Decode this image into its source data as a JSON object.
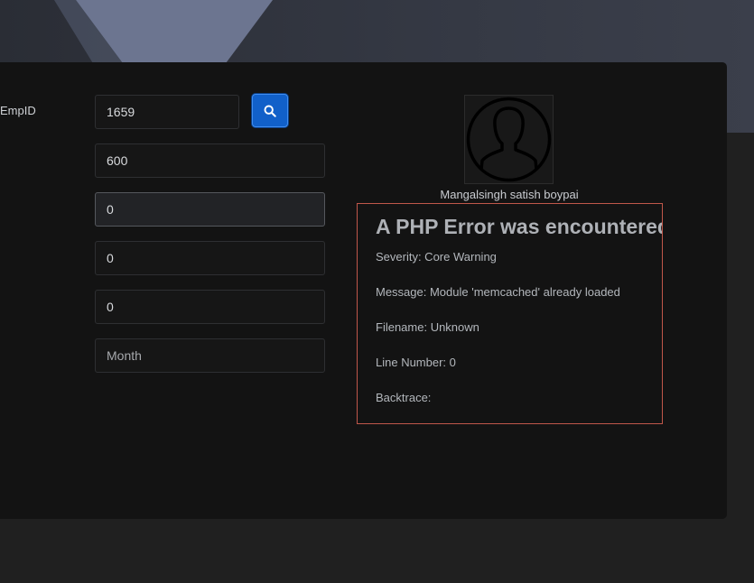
{
  "form": {
    "empid_label": "EmpID",
    "empid_value": "1659",
    "field2_value": "600",
    "field3_value": "0",
    "field4_value": "0",
    "field5_value": "0",
    "month_placeholder": "Month"
  },
  "search_button": {
    "icon": "search-icon"
  },
  "employee": {
    "avatar_icon": "user-silhouette-icon",
    "name": "Mangalsingh satish boypai"
  },
  "error": {
    "title": "A PHP Error was encountered",
    "severity": "Severity: Core Warning",
    "message": "Message: Module 'memcached' already loaded",
    "filename": "Filename: Unknown",
    "line_number": "Line Number: 0",
    "backtrace": "Backtrace:"
  },
  "colors": {
    "background": "#202020",
    "card": "#131313",
    "accent_blue": "#1160c9",
    "error_border": "#c0574a"
  }
}
